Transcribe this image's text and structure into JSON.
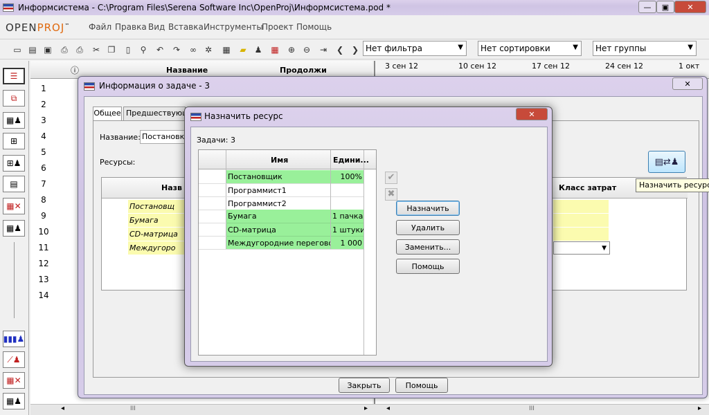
{
  "window": {
    "title": "Информсистема - C:\\Program Files\\Serena Software Inc\\OpenProj\\Информсистема.pod *",
    "min": "—",
    "max": "▣",
    "close": "✕"
  },
  "app": {
    "logo_open": "OPEN",
    "logo_proj": "PROJ",
    "logo_tm": "™"
  },
  "menu": [
    "Файл",
    "Правка",
    "Вид",
    "Вставка",
    "Инструменты",
    "Проект",
    "Помощь"
  ],
  "toolbar": {
    "filter": "Нет фильтра",
    "sort": "Нет сортировки",
    "group": "Нет группы"
  },
  "grid": {
    "col_name": "Название",
    "col_duration": "Продолжи",
    "rows": [
      "1",
      "2",
      "3",
      "4",
      "5",
      "6",
      "7",
      "8",
      "9",
      "10",
      "11",
      "12",
      "13",
      "14"
    ]
  },
  "gantt": {
    "dates": [
      "3 сен 12",
      "10 сен 12",
      "17 сен 12",
      "24 сен 12",
      "1 окт"
    ]
  },
  "task_dialog": {
    "title": "Информация о задаче - 3",
    "close": "✕",
    "tabs": [
      "Общее",
      "Предшествующ"
    ],
    "name_label": "Название:",
    "name_value": "Постановка",
    "resources_label": "Ресурсы:",
    "col_name": "Назв",
    "col_cost": "Класс затрат",
    "resources": [
      "Постановщ",
      "Бумага",
      "CD-матрица",
      "Междугоро"
    ],
    "assign_tooltip": "Назначить ресурс",
    "close_button": "Закрыть",
    "help_button": "Помощь"
  },
  "assign_dialog": {
    "title": "Назначить ресурс",
    "close": "✕",
    "tasks_label": "Задачи: 3",
    "col_name": "Имя",
    "col_units": "Едини...",
    "rows": [
      {
        "name": "Постановщик",
        "units": "100%",
        "assigned": true
      },
      {
        "name": "Программист1",
        "units": "",
        "assigned": false
      },
      {
        "name": "Программист2",
        "units": "",
        "assigned": false
      },
      {
        "name": "Бумага",
        "units": "1 пачка",
        "assigned": true
      },
      {
        "name": "CD-матрица",
        "units": "1 штуки",
        "assigned": true
      },
      {
        "name": "Междугородние переговоры",
        "units": "1 000",
        "assigned": true
      }
    ],
    "assign_button": "Назначить",
    "remove_button": "Удалить",
    "replace_button": "Заменить...",
    "help_button": "Помощь"
  },
  "scroll": {
    "grip": "III"
  }
}
